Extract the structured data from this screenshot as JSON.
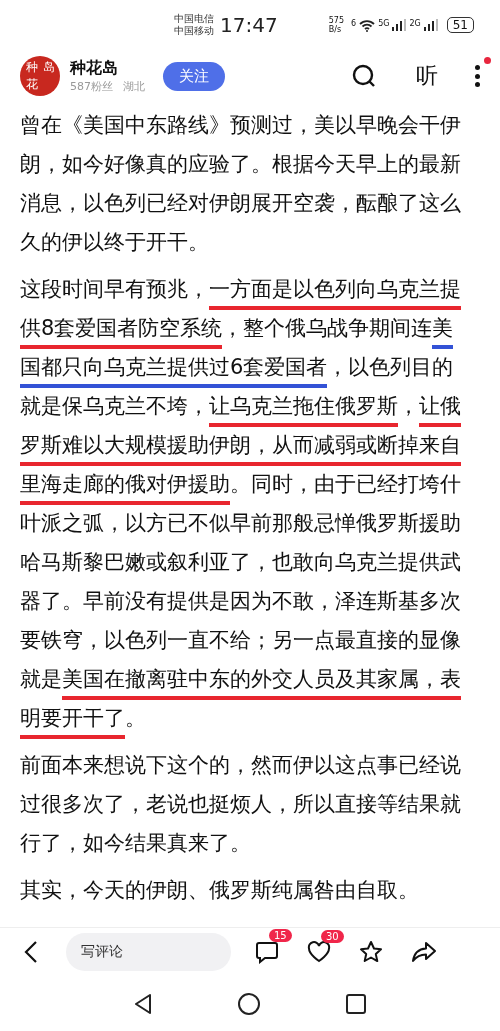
{
  "status_bar": {
    "carriers": [
      "中国电信",
      "中国移动"
    ],
    "time": "17:47",
    "speed": [
      "575",
      "B/s"
    ],
    "wifi_label": "6",
    "signal_labels": [
      "5G",
      "2G"
    ],
    "battery": "51"
  },
  "header": {
    "avatar_chars": [
      "种",
      "岛",
      "花"
    ],
    "name": "种花岛",
    "followers": "587粉丝",
    "region": "湖北",
    "follow_button": "关注",
    "listen": "听",
    "notification_dot": true
  },
  "article": [
    {
      "segments": [
        {
          "text": "曾在《美国中东路线》预测过，美以早晚会干伊朗，如今好像真的应验了。根据今天早上的最新消息，以色列已经对伊朗展开空袭，酝酿了这么久的伊以终于开干。"
        }
      ]
    },
    {
      "segments": [
        {
          "text": "这段时间早有预兆，"
        },
        {
          "text": "一方面是以色列向乌克兰提供8套爱国者防空系统",
          "color": "#e8262e"
        },
        {
          "text": "，整个俄乌战争期间连"
        },
        {
          "text": "美国都只向乌克兰提供过6套爱国者",
          "color": "#3352d6"
        },
        {
          "text": "，以色列目的就是保乌克兰不垮，"
        },
        {
          "text": "让乌克兰拖住俄罗斯",
          "color": "#e8262e"
        },
        {
          "text": "，"
        },
        {
          "text": "让俄罗斯难以大规模援助伊朗，从而减弱或断掉来自里海走廊的俄对伊援助",
          "color": "#e8262e"
        },
        {
          "text": "。同时，由于已经打垮什叶派之弧，以方已不似早前那般忌惮俄罗斯援助哈马斯黎巴嫩或叙利亚了，也敢向乌克兰提供武器了。早前没有提供是因为不敢，泽连斯基多次要铁穹，以色列一直不给；另一点最直接的显像就是"
        },
        {
          "text": "美国在撤离驻中东的外交人员及其家属，表明要开干了",
          "color": "#e8262e"
        },
        {
          "text": "。"
        }
      ]
    },
    {
      "segments": [
        {
          "text": "前面本来想说下这个的，然而伊以这点事已经说过很多次了，老说也挺烦人，所以直接等结果就行了，如今结果真来了。"
        }
      ]
    },
    {
      "segments": [
        {
          "text": "其实，今天的伊朗、俄罗斯纯属咎由自取。"
        }
      ]
    }
  ],
  "bottom_bar": {
    "comment_placeholder": "写评论",
    "comment_count": "15",
    "like_count": "30"
  }
}
